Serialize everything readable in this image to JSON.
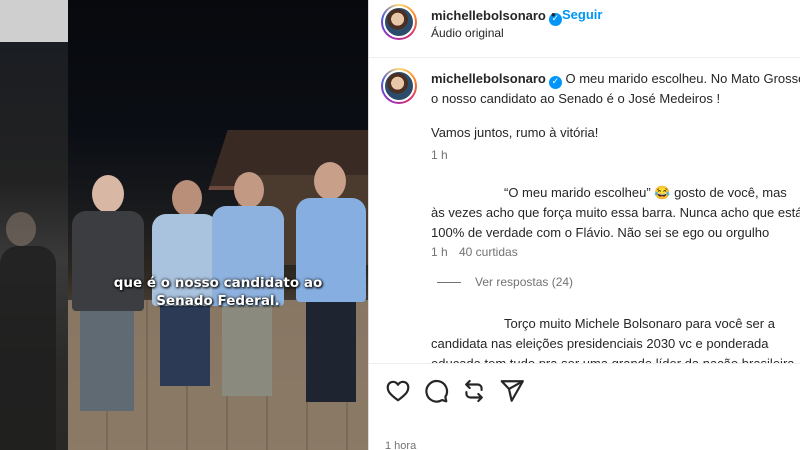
{
  "video": {
    "caption_line1": "que é o nosso candidato ao",
    "caption_line2": "Senado Federal."
  },
  "post": {
    "header": {
      "username": "michellebolsonaro",
      "dot": "•",
      "follow_label": "Seguir",
      "audio_label": "Áudio original"
    },
    "caption": {
      "username": "michellebolsonaro",
      "line1_text": "O meu marido escolheu. No Mato Grosso",
      "line2": "o nosso candidato ao Senado é o José Medeiros !",
      "line3": "Vamos juntos, rumo à vitória!",
      "time": "1 h"
    },
    "comments": [
      {
        "line1": "“O meu marido escolheu” 😂 gosto de você, mas",
        "line2": "às vezes acho que força muito essa barra. Nunca acho que está",
        "line3": "100% de verdade com o Flávio. Não sei se ego ou orgulho",
        "time": "1 h",
        "likes": "40 curtidas",
        "replies_label": "Ver respostas (24)"
      },
      {
        "line1": "Torço muito Michele Bolsonaro para você ser a",
        "line2": "candidata nas eleições presidenciais 2030 vc e ponderada",
        "line3": "educada tem tudo pra ser uma grande líder da nação brasileira"
      }
    ],
    "actions": {
      "like_icon": "heart-icon",
      "comment_icon": "comment-icon",
      "repost_icon": "repost-icon",
      "share_icon": "send-icon"
    },
    "bottom_time": "1 hora"
  },
  "colors": {
    "accent": "#0095f6",
    "text": "#262626",
    "muted": "#737373"
  }
}
